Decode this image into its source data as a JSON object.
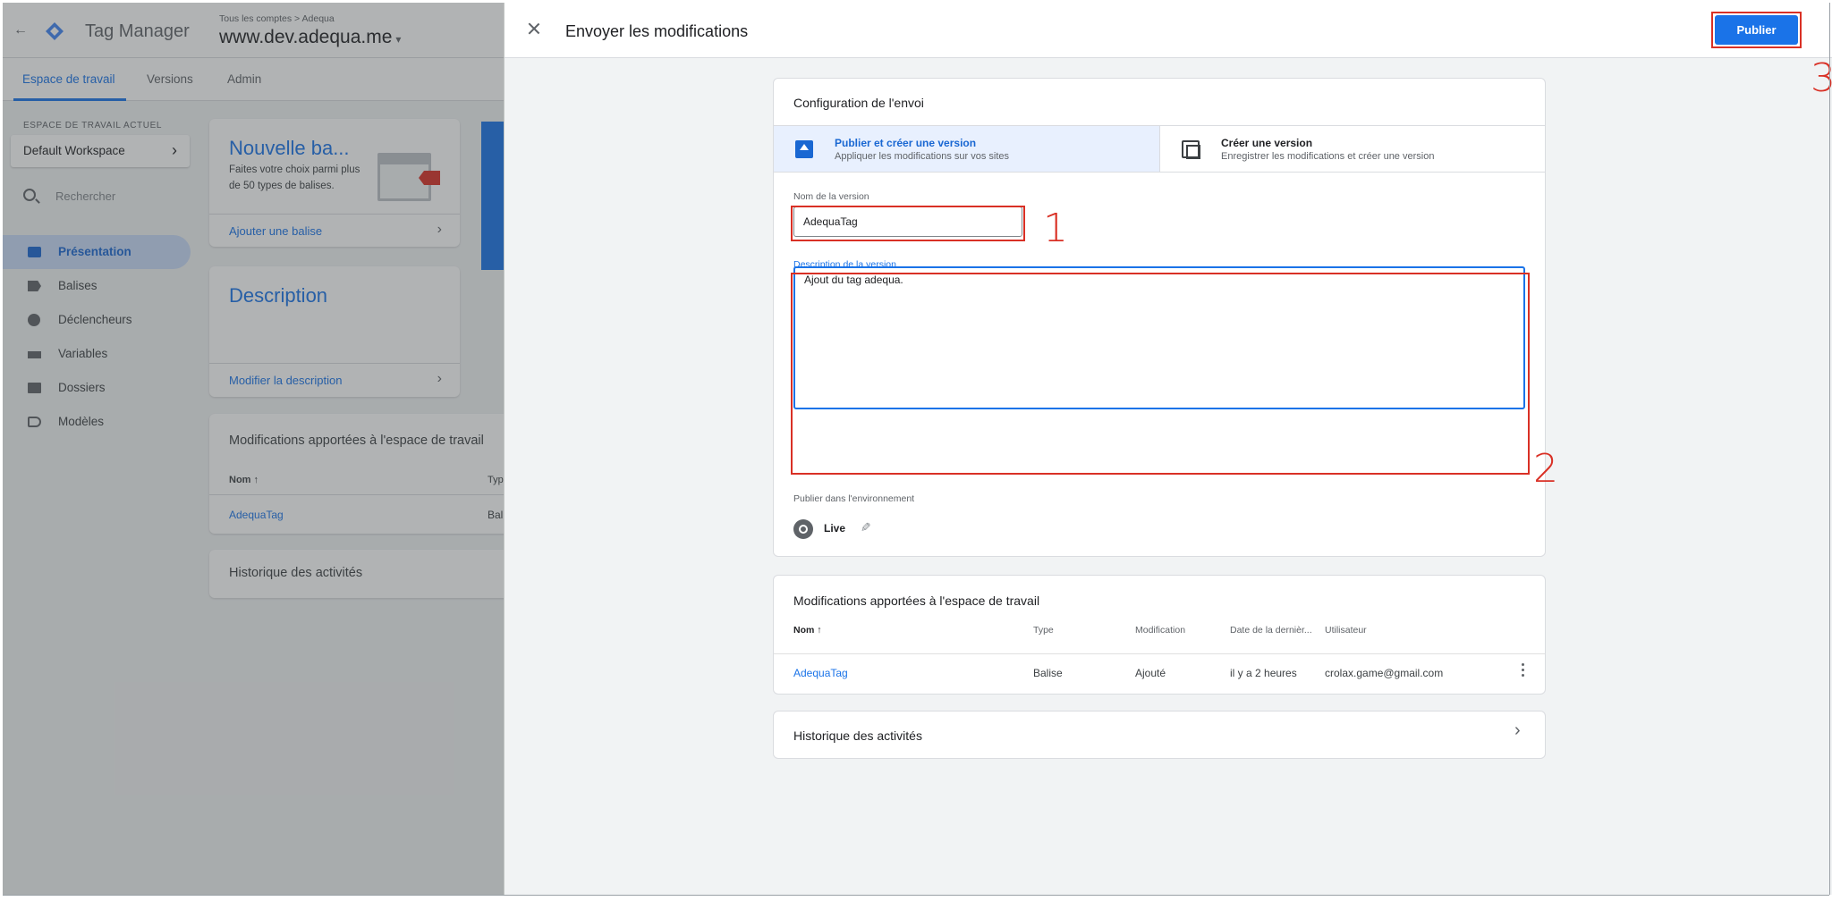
{
  "app": {
    "product": "Tag Manager",
    "breadcrumb": "Tous les comptes > Adequa",
    "container": "www.dev.adequa.me",
    "tabs": [
      "Espace de travail",
      "Versions",
      "Admin"
    ]
  },
  "sidebar": {
    "workspace_caption": "ESPACE DE TRAVAIL ACTUEL",
    "workspace_name": "Default Workspace",
    "search_placeholder": "Rechercher",
    "items": [
      {
        "label": "Présentation",
        "icon": "overview-icon",
        "active": true
      },
      {
        "label": "Balises",
        "icon": "tag-icon",
        "active": false
      },
      {
        "label": "Déclencheurs",
        "icon": "trigger-icon",
        "active": false
      },
      {
        "label": "Variables",
        "icon": "variables-icon",
        "active": false
      },
      {
        "label": "Dossiers",
        "icon": "folder-icon",
        "active": false
      },
      {
        "label": "Modèles",
        "icon": "template-icon",
        "active": false
      }
    ]
  },
  "overview": {
    "new_tag_title": "Nouvelle ba...",
    "new_tag_desc": "Faites votre choix parmi plus de 50 types de balises.",
    "new_tag_link": "Ajouter une balise",
    "description_title": "Description",
    "description_link": "Modifier la description",
    "changes_title": "Modifications apportées à l'espace de travail",
    "changes_col_name": "Nom",
    "changes_col_type": "Typ",
    "changes_row_name": "AdequaTag",
    "changes_row_type": "Bal",
    "history_title": "Historique des activités"
  },
  "panel": {
    "title": "Envoyer les modifications",
    "publish_label": "Publier",
    "config_title": "Configuration de l'envoi",
    "option_publish_title": "Publier et créer une version",
    "option_publish_desc": "Appliquer les modifications sur vos sites",
    "option_version_title": "Créer une version",
    "option_version_desc": "Enregistrer les modifications et créer une version",
    "version_name_label": "Nom de la version",
    "version_name_value": "AdequaTag",
    "version_desc_label": "Description de la version",
    "version_desc_value": "Ajout du tag adequa.",
    "env_label": "Publier dans l'environnement",
    "env_name": "Live"
  },
  "changes": {
    "title": "Modifications apportées à l'espace de travail",
    "columns": [
      "Nom",
      "Type",
      "Modification",
      "Date de la dernièr...",
      "Utilisateur"
    ],
    "rows": [
      {
        "name": "AdequaTag",
        "type": "Balise",
        "modification": "Ajouté",
        "date": "il y a 2 heures",
        "user": "crolax.game@gmail.com"
      }
    ]
  },
  "history": {
    "title": "Historique des activités"
  },
  "annotations": [
    "1",
    "2",
    "3"
  ],
  "colors": {
    "accent": "#1a73e8",
    "highlight": "#d93025",
    "selected_bg": "#e8f0fe"
  }
}
